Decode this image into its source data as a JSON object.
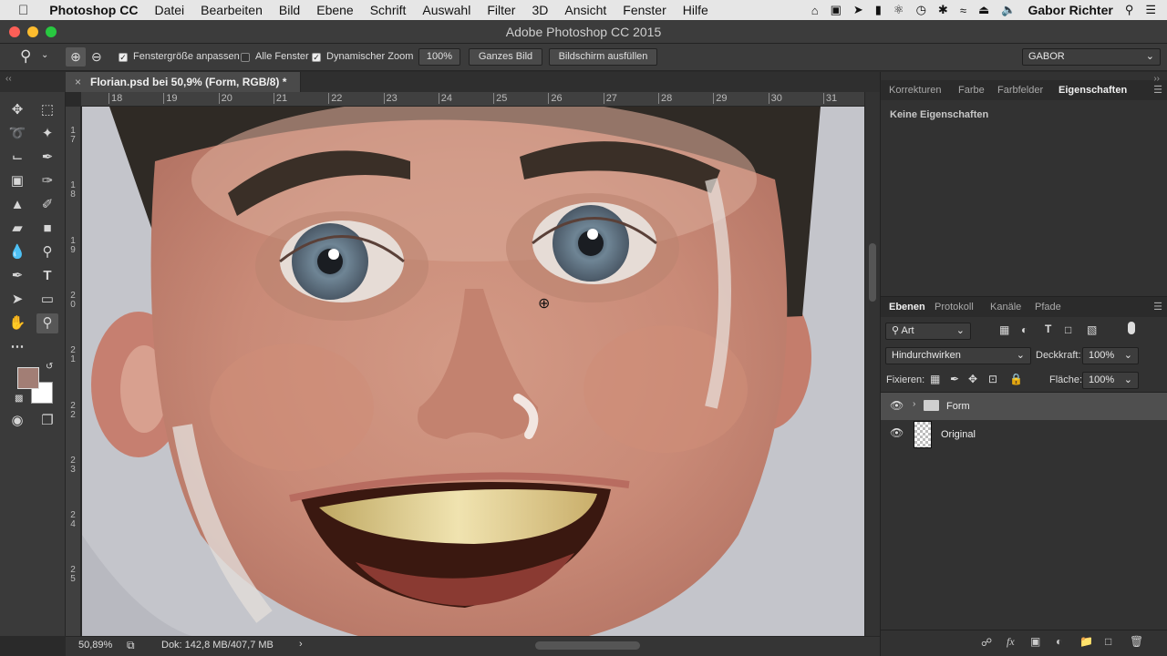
{
  "menubar": {
    "app_name": "Photoshop CC",
    "items": [
      "Datei",
      "Bearbeiten",
      "Bild",
      "Ebene",
      "Schrift",
      "Auswahl",
      "Filter",
      "3D",
      "Ansicht",
      "Fenster",
      "Hilfe"
    ],
    "user": "Gabor Richter"
  },
  "window": {
    "title": "Adobe Photoshop CC 2015"
  },
  "options": {
    "resize_windows": "Fenstergröße anpassen",
    "all_windows": "Alle Fenster",
    "dynamic_zoom": "Dynamischer Zoom",
    "zoom_value": "100%",
    "fit_screen": "Ganzes Bild",
    "fill_screen": "Bildschirm ausfüllen",
    "workspace": "GABOR"
  },
  "document": {
    "tab_title": "Florian.psd bei 50,9% (Form, RGB/8) *"
  },
  "ruler": {
    "h": [
      "18",
      "19",
      "20",
      "21",
      "22",
      "23",
      "24",
      "25",
      "26",
      "27",
      "28",
      "29",
      "30",
      "31"
    ],
    "v": [
      "1\n7",
      "1\n8",
      "1\n9",
      "2\n0",
      "2\n1",
      "2\n2",
      "2\n3",
      "2\n4",
      "2\n5"
    ]
  },
  "status": {
    "zoom": "50,89%",
    "doc": "Dok: 142,8 MB/407,7 MB"
  },
  "panels": {
    "top_tabs": [
      "Korrekturen",
      "Farbe",
      "Farbfelder",
      "Eigenschaften"
    ],
    "properties_text": "Keine Eigenschaften",
    "layer_tabs": [
      "Ebenen",
      "Protokoll",
      "Kanäle",
      "Pfade"
    ],
    "filter_kind": "Art",
    "blend_mode": "Hindurchwirken",
    "opacity_label": "Deckkraft:",
    "opacity_value": "100%",
    "lock_label": "Fixieren:",
    "fill_label": "Fläche:",
    "fill_value": "100%",
    "layers": [
      {
        "name": "Form"
      },
      {
        "name": "Original"
      }
    ]
  },
  "colors": {
    "foreground": "#a27e75",
    "background": "#ffffff",
    "ui_dark": "#323232",
    "ui_selected_layer": "#4f4f4f"
  }
}
